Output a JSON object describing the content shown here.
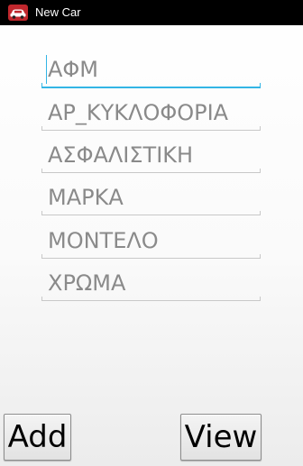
{
  "titlebar": {
    "title": "New Car",
    "icon": "car-icon",
    "background": "#000000"
  },
  "form": {
    "accent": "#33b5e5",
    "fields": [
      {
        "placeholder": "ΑΦΜ",
        "value": "",
        "focused": true
      },
      {
        "placeholder": "ΑΡ_ΚΥΚΛΟΦΟΡΙΑ",
        "value": ""
      },
      {
        "placeholder": "ΑΣΦΑΛΙΣΤΙΚΗ",
        "value": ""
      },
      {
        "placeholder": "ΜΑΡΚΑ",
        "value": ""
      },
      {
        "placeholder": "ΜΟΝΤΕΛΟ",
        "value": ""
      },
      {
        "placeholder": "ΧΡΩΜΑ",
        "value": ""
      }
    ]
  },
  "actions": {
    "add_label": "Add",
    "view_label": "View"
  }
}
